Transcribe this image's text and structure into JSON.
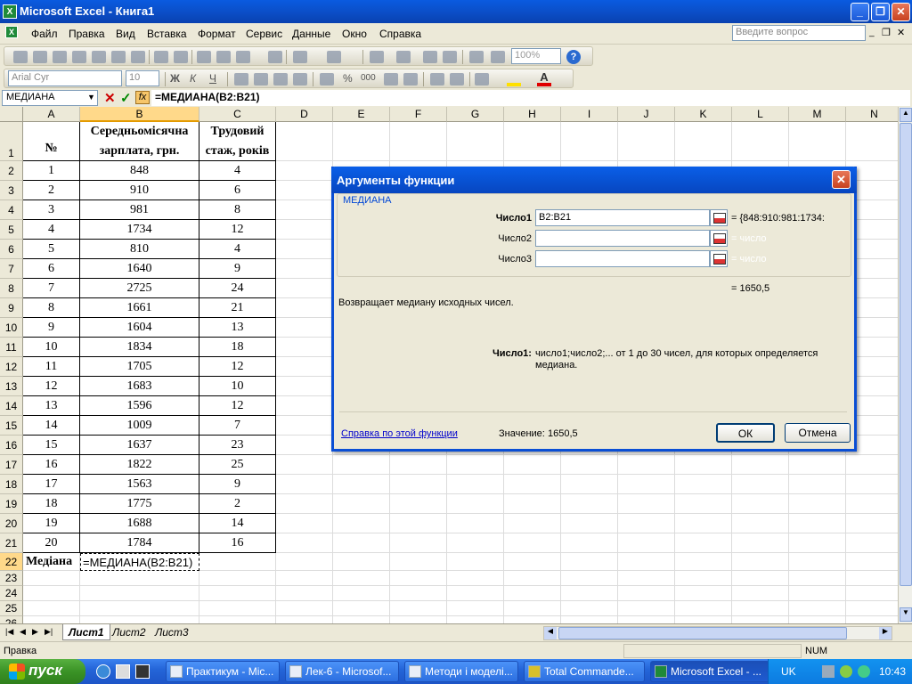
{
  "window": {
    "title": "Microsoft Excel - Книга1",
    "icon": "excel-icon"
  },
  "menu": {
    "items": [
      "Файл",
      "Правка",
      "Вид",
      "Вставка",
      "Формат",
      "Сервис",
      "Данные",
      "Окно",
      "Справка"
    ],
    "help_placeholder": "Введите вопрос"
  },
  "toolbar": {
    "zoom": "100%",
    "font": "Arial Cyr",
    "size": "10"
  },
  "formula_bar": {
    "name_box": "МЕДИАНА",
    "formula": "=МЕДИАНА(B2:B21)"
  },
  "grid": {
    "columns": [
      "A",
      "B",
      "C",
      "D",
      "E",
      "F",
      "G",
      "H",
      "I",
      "J",
      "K",
      "L",
      "M",
      "N"
    ],
    "header_row": {
      "a": "№",
      "b1": "Середньомісячна",
      "b2": "зарплата, грн.",
      "c1": "Трудовий",
      "c2": "стаж, років"
    },
    "rows": [
      {
        "n": "1",
        "b": "848",
        "c": "4"
      },
      {
        "n": "2",
        "b": "910",
        "c": "6"
      },
      {
        "n": "3",
        "b": "981",
        "c": "8"
      },
      {
        "n": "4",
        "b": "1734",
        "c": "12"
      },
      {
        "n": "5",
        "b": "810",
        "c": "4"
      },
      {
        "n": "6",
        "b": "1640",
        "c": "9"
      },
      {
        "n": "7",
        "b": "2725",
        "c": "24"
      },
      {
        "n": "8",
        "b": "1661",
        "c": "21"
      },
      {
        "n": "9",
        "b": "1604",
        "c": "13"
      },
      {
        "n": "10",
        "b": "1834",
        "c": "18"
      },
      {
        "n": "11",
        "b": "1705",
        "c": "12"
      },
      {
        "n": "12",
        "b": "1683",
        "c": "10"
      },
      {
        "n": "13",
        "b": "1596",
        "c": "12"
      },
      {
        "n": "14",
        "b": "1009",
        "c": "7"
      },
      {
        "n": "15",
        "b": "1637",
        "c": "23"
      },
      {
        "n": "16",
        "b": "1822",
        "c": "25"
      },
      {
        "n": "17",
        "b": "1563",
        "c": "9"
      },
      {
        "n": "18",
        "b": "1775",
        "c": "2"
      },
      {
        "n": "19",
        "b": "1688",
        "c": "14"
      },
      {
        "n": "20",
        "b": "1784",
        "c": "16"
      }
    ],
    "row22_label": "Медіана",
    "row22_formula": "=МЕДИАНА(B2:B21)"
  },
  "sheets": [
    "Лист1",
    "Лист2",
    "Лист3"
  ],
  "status": {
    "left": "Правка",
    "num": "NUM"
  },
  "dialog": {
    "title": "Аргументы функции",
    "function_name": "МЕДИАНА",
    "args": [
      {
        "label": "Число1",
        "value": "B2:B21",
        "result": "= {848:910:981:1734:"
      },
      {
        "label": "Число2",
        "value": "",
        "result": "= число"
      },
      {
        "label": "Число3",
        "value": "",
        "result": "= число"
      }
    ],
    "result": "= 1650,5",
    "description": "Возвращает медиану исходных чисел.",
    "arg_help_label": "Число1:",
    "arg_help_text": "число1;число2;... от 1 до 30 чисел, для которых определяется медиана.",
    "help_link": "Справка по этой функции",
    "value_label": "Значение:",
    "value": "1650,5",
    "ok": "ОК",
    "cancel": "Отмена"
  },
  "taskbar": {
    "start": "пуск",
    "tasks": [
      "Практикум - Mic...",
      "Лек-6 - Microsof...",
      "Методи і моделі...",
      "Total Commande...",
      "Microsoft Excel - ..."
    ],
    "lang": "UK",
    "clock": "10:43"
  }
}
